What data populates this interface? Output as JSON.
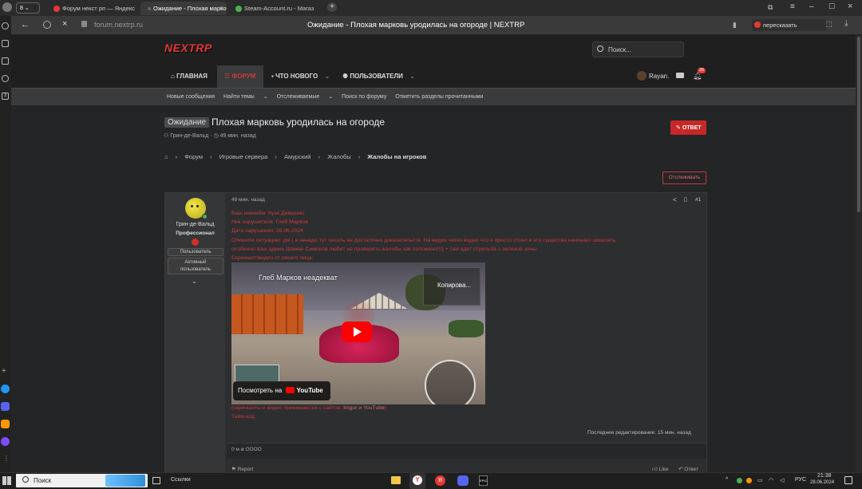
{
  "browser": {
    "tab_count": "8",
    "tabs": [
      {
        "label": "Форум некст рп — Яндекс",
        "icon_color": "#e53935"
      },
      {
        "label": "Ожидание - Плохая марковь",
        "icon_color": "#666666"
      },
      {
        "label": "Steam-Account.ru - Магаз",
        "icon_color": "#4caf50"
      }
    ],
    "url": "forum.nextrp.ru",
    "page_title": "Ожидание - Плохая марковь уродилась на огороде | NEXTRP",
    "translate_label": "пересказать"
  },
  "forum": {
    "logo": "NEXTRP",
    "search_placeholder": "Поиск...",
    "nav": {
      "home": "ГЛАВНАЯ",
      "forum": "ФОРУМ",
      "whats_new": "ЧТО НОВОГО",
      "users": "ПОЛЬЗОВАТЕЛИ"
    },
    "username": "Rayan.",
    "notification_count": "26",
    "subnav": [
      "Новые сообщения",
      "Найти темы",
      "Отслеживаемые",
      "Поиск по форуму",
      "Отметить разделы прочитанными"
    ],
    "thread": {
      "prefix": "Ожидание",
      "title": "Плохая марковь уродилась на огороде",
      "author": "Грин-де-Вальд",
      "time": "49 мин. назад",
      "reply_label": "ОТВЕТ",
      "watch_label": "Отслеживать"
    },
    "breadcrumbs": [
      "Форум",
      "Игровые сервера",
      "Амурский",
      "Жалобы",
      "Жалобы на игроков"
    ],
    "post": {
      "author": "Грин-де-Вальд",
      "rank": "Профессионал",
      "badges": [
        "Пользователь",
        "Активный пользователь"
      ],
      "time": "49 мин. назад",
      "number": "#1",
      "lines": [
        "Ваш никнейм: Кузя Деверекс",
        "Ник нарушителя: Глеб Марков",
        "Дата нарушения: 28.06.2024",
        "Опишите ситуацию: дм ( я ненадо тут писать не достаточно доказательств. На видио четко видно что я просто стоял в это существо начинает шмалять,",
        "особенно ваш админ Шаман Симонов любит не проверять жалобы как положено!!!) + там едет стрельба с зеленой зоны",
        "Скриншот/видео от своего лица:"
      ],
      "video": {
        "title": "Глеб Марков неадекват",
        "overlay_text": "Копирова...",
        "watch_label": "Посмотреть на",
        "yt": "YouTube"
      },
      "footer_note_prefix": "(скриншоты и видео принимаются с сайтов:",
      "footer_note_sites": "Imgur и YouTube",
      "footer_note_suffix": ")",
      "timecodes": "Тайм-код:",
      "last_edit": "Последнее редактирование: 15 мин. назад",
      "reactions": "0 м ø ОООО",
      "report": "Report",
      "like": "Like",
      "reply": "Ответ"
    }
  },
  "taskbar": {
    "search": "Поиск",
    "links": "Ссылки",
    "lang": "РУС",
    "time": "21:38",
    "date": "28.06.2024"
  },
  "colors": {
    "accent": "#d32f2f",
    "bg": "#242526",
    "panel": "#2d2e30"
  }
}
